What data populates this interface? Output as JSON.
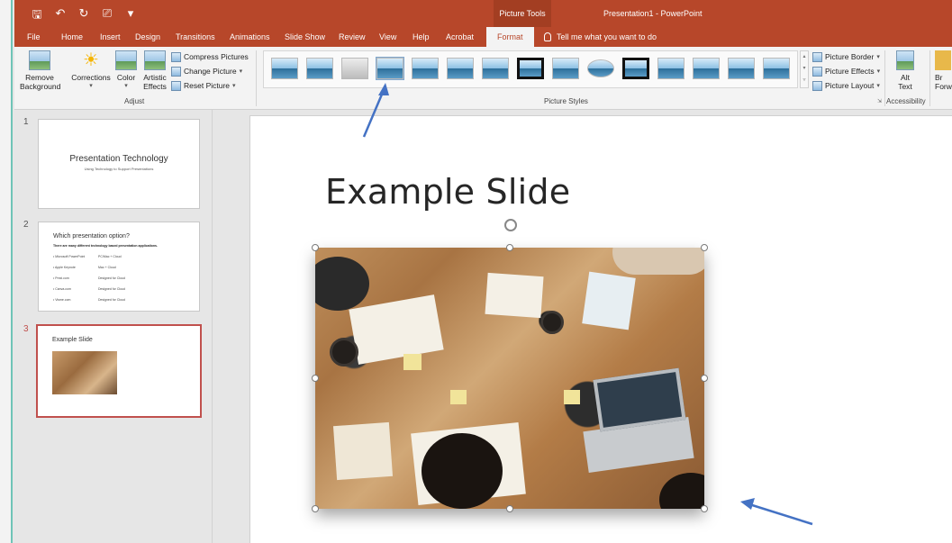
{
  "window": {
    "picture_tools": "Picture Tools",
    "title": "Presentation1  -  PowerPoint"
  },
  "tabs": [
    "File",
    "Home",
    "Insert",
    "Design",
    "Transitions",
    "Animations",
    "Slide Show",
    "Review",
    "View",
    "Help",
    "Acrobat",
    "Format"
  ],
  "tell_me": "Tell me what you want to do",
  "ribbon": {
    "remove_bg": [
      "Remove",
      "Background"
    ],
    "corrections": "Corrections",
    "color": "Color",
    "artistic": [
      "Artistic",
      "Effects"
    ],
    "compress": "Compress Pictures",
    "change": "Change Picture",
    "reset": "Reset Picture",
    "adjust_label": "Adjust",
    "styles_label": "Picture Styles",
    "border": "Picture Border",
    "effects": "Picture Effects",
    "layout": "Picture Layout",
    "alt": [
      "Alt",
      "Text"
    ],
    "accessibility_label": "Accessibility",
    "bring": [
      "Br",
      "Forw"
    ]
  },
  "slides": [
    {
      "num": "1",
      "title": "Presentation Technology",
      "subtitle": "Using Technology to Support Presentations"
    },
    {
      "num": "2",
      "title": "Which presentation option?",
      "lead": "There are many different technology based presentation applications.",
      "rows": [
        [
          "• Microsoft PowerPoint",
          "PC/Mac + Cloud"
        ],
        [
          "• Apple Keynote",
          "Mac + Cloud"
        ],
        [
          "• Prezi.com",
          "Designed for Cloud"
        ],
        [
          "• Canva.com",
          "Designed for Cloud"
        ],
        [
          "• Visme.com",
          "Designed for Cloud"
        ]
      ]
    },
    {
      "num": "3",
      "title": "Example Slide"
    }
  ],
  "main_slide": {
    "title": "Example Slide"
  },
  "colors": {
    "accent": "#b7472a",
    "selected": "#c0504d",
    "arrow": "#4472c4"
  }
}
